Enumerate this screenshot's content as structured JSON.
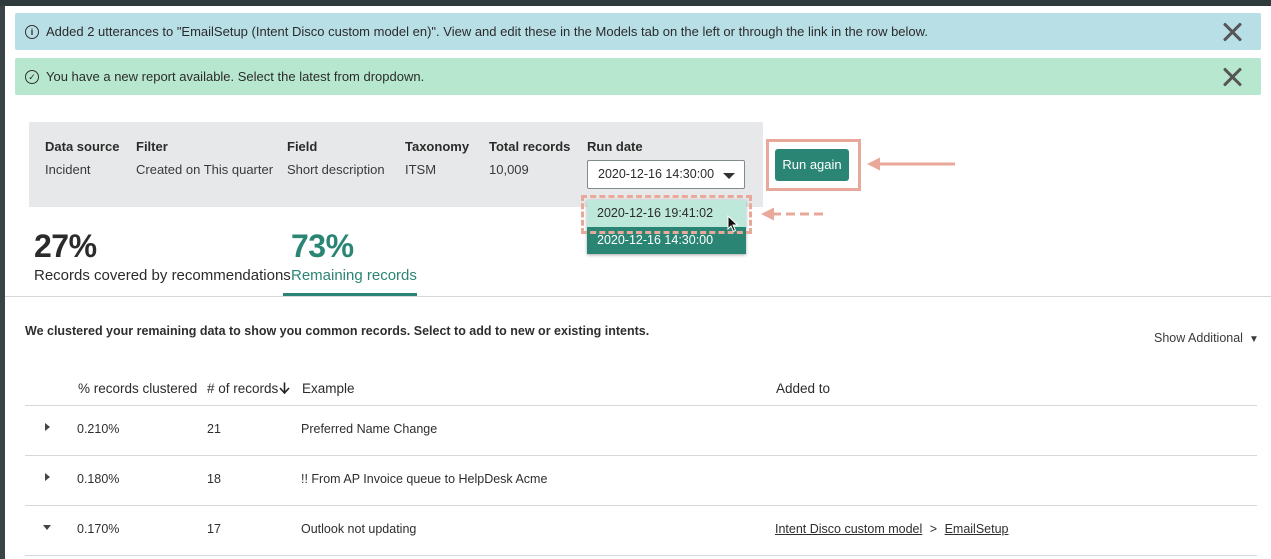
{
  "banners": {
    "info": {
      "icon": "info-icon",
      "text": "Added 2 utterances to \"EmailSetup (Intent Disco custom model en)\". View and edit these in the Models tab on the left or through the link in the row below."
    },
    "success": {
      "icon": "check-circle-icon",
      "text": "You have a new report available. Select the latest from dropdown."
    }
  },
  "summary": {
    "data_source": {
      "label": "Data source",
      "value": "Incident"
    },
    "filter": {
      "label": "Filter",
      "value": "Created on This quarter"
    },
    "field": {
      "label": "Field",
      "value": "Short description"
    },
    "taxonomy": {
      "label": "Taxonomy",
      "value": "ITSM"
    },
    "total_records": {
      "label": "Total records",
      "value": "10,009"
    },
    "run_date": {
      "label": "Run date",
      "selected": "2020-12-16 14:30:00",
      "options": [
        "2020-12-16 19:41:02",
        "2020-12-16 14:30:00"
      ]
    },
    "run_again_label": "Run again"
  },
  "stats": {
    "covered": {
      "value": "27%",
      "label": "Records covered by recommendations"
    },
    "remaining": {
      "value": "73%",
      "label": "Remaining records"
    }
  },
  "intro_text": "We clustered your remaining data to show you common records. Select to add to new or existing intents.",
  "show_additional": "Show Additional",
  "table": {
    "headers": {
      "pct": "% records clustered",
      "count": "# of records",
      "example": "Example",
      "added_to": "Added to"
    },
    "rows": [
      {
        "pct": "0.210%",
        "count": "21",
        "example": "Preferred Name Change",
        "added_to": "",
        "added_to_model": "",
        "added_to_intent": "",
        "expanded": false
      },
      {
        "pct": "0.180%",
        "count": "18",
        "example": "!! From AP Invoice queue to HelpDesk Acme",
        "added_to": "",
        "added_to_model": "",
        "added_to_intent": "",
        "expanded": false
      },
      {
        "pct": "0.170%",
        "count": "17",
        "example": "Outlook not updating",
        "added_to_model": "Intent Disco custom model",
        "added_to_sep": ">",
        "added_to_intent": "EmailSetup",
        "expanded": true
      }
    ]
  },
  "colors": {
    "accent": "#2b8574",
    "info_banner": "#b8dfe6",
    "success_banner": "#b7e8cf",
    "highlight": "#e8a89a"
  }
}
